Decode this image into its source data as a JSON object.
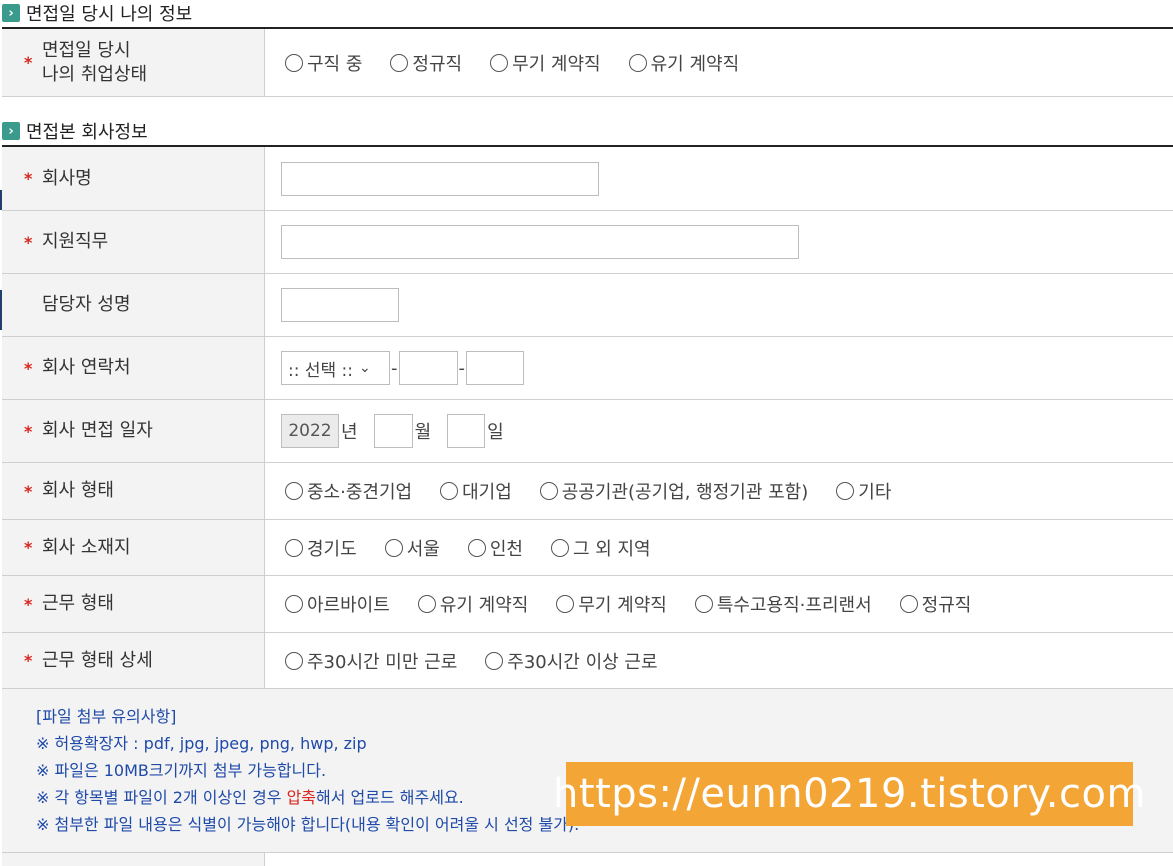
{
  "section1": {
    "title": "면접일 당시 나의 정보"
  },
  "employment": {
    "label_line1": "면접일 당시",
    "label_line2": "나의 취업상태",
    "options": [
      "구직 중",
      "정규직",
      "무기 계약직",
      "유기 계약직"
    ]
  },
  "section2": {
    "title": "면접본 회사정보"
  },
  "company_name": {
    "label": "회사명"
  },
  "position": {
    "label": "지원직무"
  },
  "manager": {
    "label": "담당자 성명"
  },
  "contact": {
    "label": "회사 연락처",
    "select_value": ":: 선택 ::",
    "dash": "-"
  },
  "interview_date": {
    "label": "회사 면접 일자",
    "year": "2022",
    "year_unit": "년",
    "month_unit": "월",
    "day_unit": "일"
  },
  "company_type": {
    "label": "회사 형태",
    "options": [
      "중소·중견기업",
      "대기업",
      "공공기관(공기업, 행정기관 포함)",
      "기타"
    ]
  },
  "location": {
    "label": "회사 소재지",
    "options": [
      "경기도",
      "서울",
      "인천",
      "그 외 지역"
    ]
  },
  "work_type": {
    "label": "근무 형태",
    "options": [
      "아르바이트",
      "유기 계약직",
      "무기 계약직",
      "특수고용직·프리랜서",
      "정규직"
    ]
  },
  "work_detail": {
    "label": "근무 형태 상세",
    "options": [
      "주30시간 미만 근로",
      "주30시간 이상 근로"
    ]
  },
  "required_mark": "*",
  "notes": {
    "heading": "[파일 첨부 유의사항]",
    "bullet": "※",
    "line1": "허용확장자 : pdf, jpg, jpeg, png, hwp, zip",
    "line2": "파일은 10MB크기까지 첨부 가능합니다.",
    "line3_pre": "각 항목별 파일이 2개 이상인 경우 ",
    "line3_red": "압축",
    "line3_post": "해서 업로드 해주세요.",
    "line4": "첨부한 파일 내용은 식별이 가능해야 합니다(내용 확인이 어려울 시 선정 불가)."
  },
  "watermark": "https://eunn0219.tistory.com",
  "colors": {
    "accent": "#3a9a8c",
    "required": "#d8261e",
    "note_text": "#1f4aa8",
    "watermark_bg": "#f3a535"
  }
}
